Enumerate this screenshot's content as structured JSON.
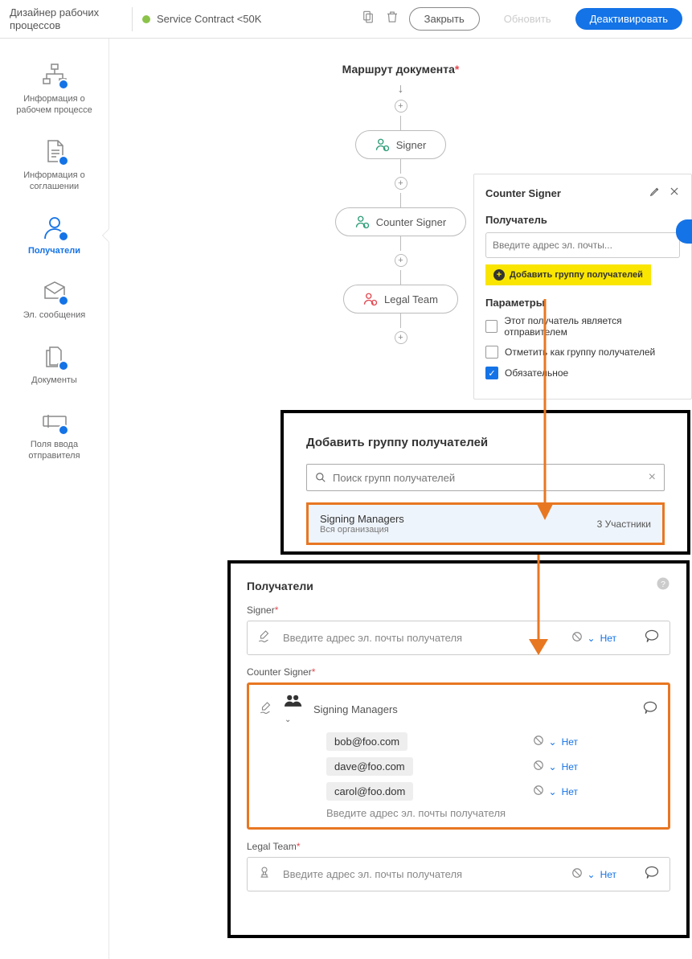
{
  "header": {
    "title": "Дизайнер рабочих процессов",
    "docName": "Service Contract <50K",
    "closeBtn": "Закрыть",
    "refreshBtn": "Обновить",
    "deactivateBtn": "Деактивировать"
  },
  "sidebar": {
    "items": [
      {
        "label": "Информация о рабочем процессе"
      },
      {
        "label": "Информация о соглашении"
      },
      {
        "label": "Получатели"
      },
      {
        "label": "Эл. сообщения"
      },
      {
        "label": "Документы"
      },
      {
        "label": "Поля ввода отправителя"
      }
    ]
  },
  "route": {
    "title": "Маршрут документа",
    "nodes": [
      "Signer",
      "Counter Signer",
      "Legal Team"
    ]
  },
  "panel": {
    "title": "Counter Signer",
    "recipientLabel": "Получатель",
    "emailPlaceholder": "Введите адрес эл. почты...",
    "addGroup": "Добавить группу получателей",
    "paramsLabel": "Параметры",
    "opt1": "Этот получатель является отправителем",
    "opt2": "Отметить как группу получателей",
    "opt3": "Обязательное"
  },
  "overlay1": {
    "title": "Добавить группу получателей",
    "searchPlaceholder": "Поиск групп получателей",
    "resultName": "Signing Managers",
    "resultSub": "Вся организация",
    "resultCount": "3 Участники"
  },
  "overlay2": {
    "title": "Получатели",
    "signerLabel": "Signer",
    "counterLabel": "Counter Signer",
    "legalLabel": "Legal Team",
    "placeholder": "Введите адрес эл. почты получателя",
    "groupName": "Signing Managers",
    "members": [
      "bob@foo.com",
      "dave@foo.com",
      "carol@foo.dom"
    ],
    "noAuth": "Нет"
  }
}
